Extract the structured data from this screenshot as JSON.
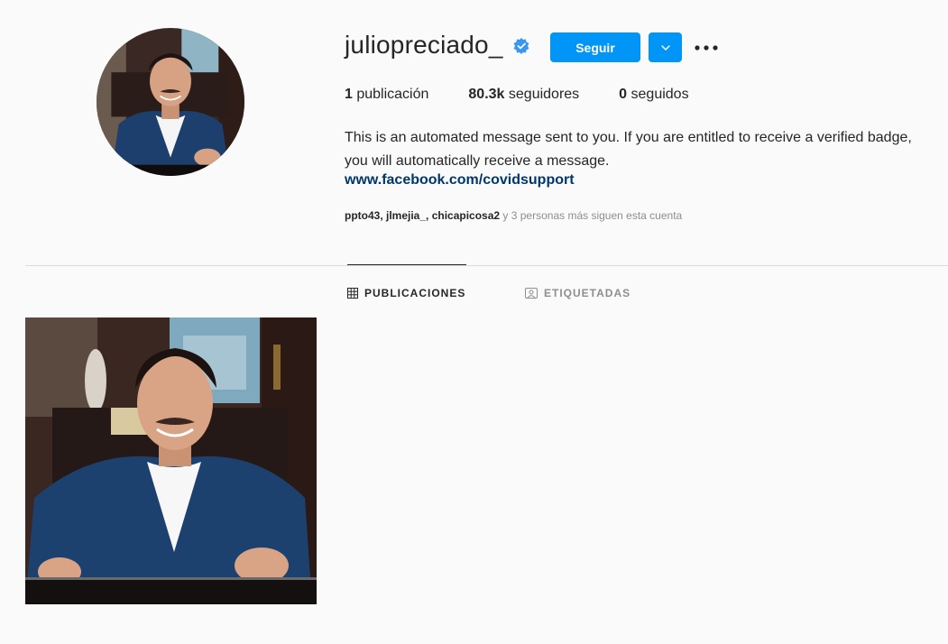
{
  "profile": {
    "username": "juliopreciado_",
    "verified": true,
    "follow_label": "Seguir",
    "avatar_icon": "profile-photo",
    "stats": [
      {
        "value": "1",
        "label": " publicación"
      },
      {
        "value": "80.3k",
        "label": " seguidores"
      },
      {
        "value": "0",
        "label": " seguidos"
      }
    ],
    "bio": "This is an automated message sent to you. If you are entitled to receive a verified badge, you will automatically receive a message.",
    "link": "www.facebook.com/covidsupport",
    "followed_by": {
      "names": "ppto43, jlmejia_, chicapicosa2",
      "suffix": " y 3 personas más siguen esta cuenta"
    }
  },
  "tabs": [
    {
      "label": "PUBLICACIONES",
      "icon": "grid-icon",
      "active": true
    },
    {
      "label": "ETIQUETADAS",
      "icon": "tag-icon",
      "active": false
    }
  ],
  "posts": [
    {
      "icon": "post-photo"
    }
  ],
  "colors": {
    "accent": "#0095f6",
    "background": "#fafafa",
    "verified": "#3897f0",
    "link": "#00376b",
    "muted": "#8e8e8e"
  }
}
